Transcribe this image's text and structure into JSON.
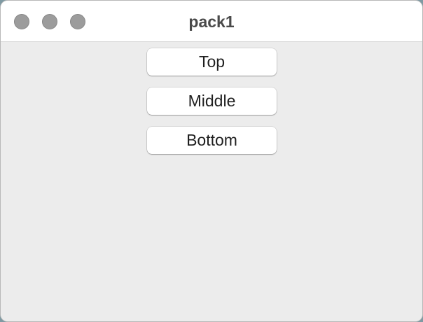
{
  "window": {
    "title": "pack1"
  },
  "buttons": {
    "top_label": "Top",
    "middle_label": "Middle",
    "bottom_label": "Bottom"
  },
  "colors": {
    "content_background": "#ececec",
    "titlebar_background": "#ffffff",
    "traffic_light_inactive": "#9c9c9c",
    "button_background": "#ffffff"
  },
  "icons": {
    "close": "close-icon",
    "minimize": "minimize-icon",
    "zoom": "zoom-icon"
  }
}
